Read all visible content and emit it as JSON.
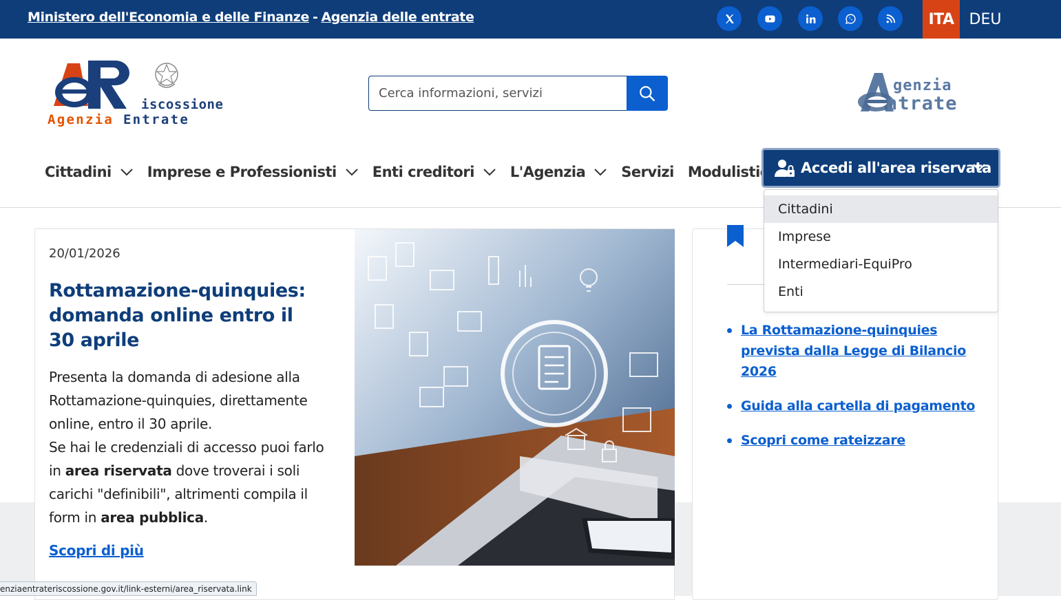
{
  "topbar": {
    "link1": "Ministero dell'Economia e delle Finanze",
    "separator": "-",
    "link2": "Agenzia delle entrate",
    "social": [
      "x-icon",
      "youtube-icon",
      "linkedin-icon",
      "whatsapp-icon",
      "rss-icon"
    ],
    "lang_active": "ITA",
    "lang_other": "DEU"
  },
  "header": {
    "logo_left_line1": "iscossione",
    "logo_left_line2a": "Agenzia",
    "logo_left_line2b": "Entrate",
    "search_placeholder": "Cerca informazioni, servizi",
    "logo_right_line1": "genzia",
    "logo_right_line2": "ntrate"
  },
  "nav": {
    "items": [
      {
        "label": "Cittadini",
        "has_menu": true
      },
      {
        "label": "Imprese e Professionisti",
        "has_menu": true
      },
      {
        "label": "Enti creditori",
        "has_menu": true
      },
      {
        "label": "L'Agenzia",
        "has_menu": true
      },
      {
        "label": "Servizi",
        "has_menu": false
      },
      {
        "label": "Modulistica",
        "has_menu": false
      }
    ],
    "access_button": "Accedi all'area riservata",
    "dropdown": [
      "Cittadini",
      "Imprese",
      "Intermediari-EquiPro",
      "Enti"
    ]
  },
  "news": {
    "date": "20/01/2026",
    "title": "Rottamazione-quinquies: domanda online entro il 30 aprile",
    "body_p1": "Presenta la domanda di adesione alla Rottamazione-quinquies, direttamente online, entro il 30 aprile.",
    "body_p2a": "Se hai le credenziali di accesso puoi farlo in",
    "body_p2b": "area riservata",
    "body_p2c": "dove troverai i soli carichi \"definibili\", altrimenti compila il form in",
    "body_p2d": "area pubblica",
    "body_p2e": ".",
    "more": "Scopri di più"
  },
  "side": {
    "links": [
      "La Rottamazione-quinquies prevista dalla Legge di Bilancio 2026",
      "Guida alla cartella di pagamento",
      "Scopri come rateizzare"
    ]
  },
  "status_url": "enziaentrateriscossione.gov.it/link-esterni/area_riservata.link",
  "colors": {
    "primary": "#0e3d7a",
    "accent": "#0b5fcf",
    "lang_active_bg": "#d84315"
  }
}
